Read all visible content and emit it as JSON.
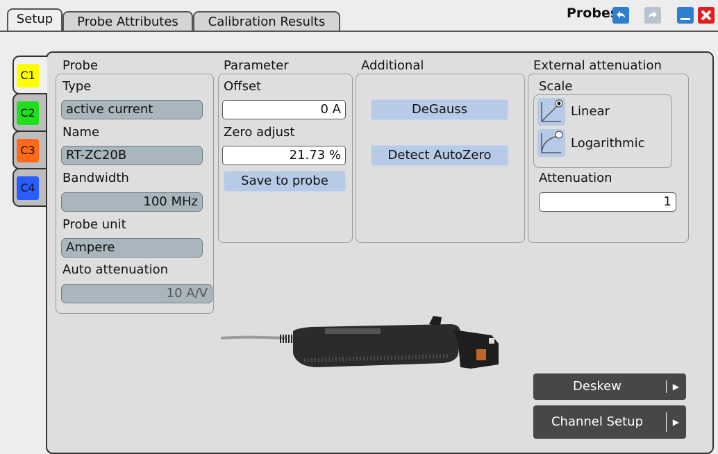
{
  "tabs": [
    "Setup",
    "Probe Attributes",
    "Calibration Results"
  ],
  "window": {
    "title": "Probes"
  },
  "channels": [
    {
      "label": "C1",
      "color": "#ffff00",
      "active": true
    },
    {
      "label": "C2",
      "color": "#22dd22"
    },
    {
      "label": "C3",
      "color": "#ff6a1a"
    },
    {
      "label": "C4",
      "color": "#2a5cff"
    }
  ],
  "probe": {
    "heading": "Probe",
    "type_label": "Type",
    "type_value": "active current",
    "name_label": "Name",
    "name_value": "RT-ZC20B",
    "bandwidth_label": "Bandwidth",
    "bandwidth_value": "100 MHz",
    "unit_label": "Probe unit",
    "unit_value": "Ampere",
    "auto_att_label": "Auto attenuation",
    "auto_att_value": "10 A/V"
  },
  "parameter": {
    "heading": "Parameter",
    "offset_label": "Offset",
    "offset_value": "0 A",
    "zero_label": "Zero adjust",
    "zero_value": "21.73 %",
    "save_label": "Save to probe"
  },
  "additional": {
    "heading": "Additional",
    "degauss_label": "DeGauss",
    "autozero_label": "Detect AutoZero"
  },
  "external": {
    "heading": "External attenuation",
    "scale_label": "Scale",
    "linear_label": "Linear",
    "log_label": "Logarithmic",
    "selected_scale": "Linear",
    "attenuation_label": "Attenuation",
    "attenuation_value": "1"
  },
  "actions": {
    "deskew_label": "Deskew",
    "channel_setup_label": "Channel Setup"
  },
  "colors": {
    "accent_button": "#b7cbe8",
    "window_blue": "#2f7fd0",
    "close_red": "#e02020"
  }
}
